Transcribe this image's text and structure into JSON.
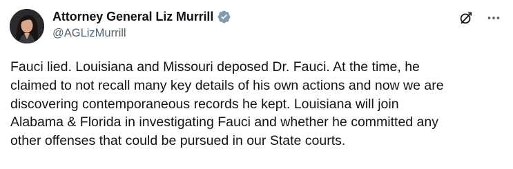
{
  "author": {
    "display_name": "Attorney General Liz Murrill",
    "handle": "@AGLizMurrill",
    "verified_icon": "verified-badge-icon",
    "avatar_icon": "avatar"
  },
  "actions": {
    "grok_icon": "grok-icon",
    "more_icon": "more-options-icon"
  },
  "post": {
    "lines": [
      "Fauci lied. Louisiana and Missouri deposed Dr. Fauci. At the time, he",
      "claimed to not recall many key details of his own actions and now we are",
      "discovering contemporaneous records he kept. Louisiana will join",
      "Alabama & Florida in investigating Fauci and whether he committed any",
      "other offenses that could be pursued in our State courts."
    ]
  },
  "colors": {
    "text": "#0f1419",
    "secondary": "#536471",
    "verified": "#829aab"
  }
}
